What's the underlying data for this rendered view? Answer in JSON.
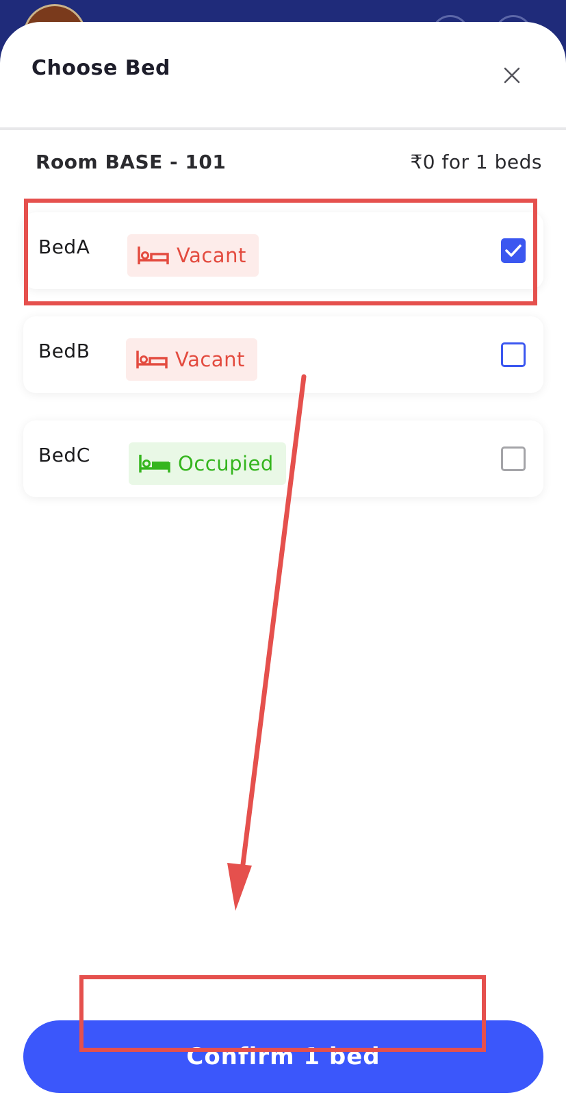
{
  "sheet": {
    "title": "Choose Bed"
  },
  "room": {
    "name": "Room BASE - 101",
    "price_summary": "₹0 for 1 beds"
  },
  "beds": [
    {
      "name": "BedA",
      "status": "Vacant",
      "checked": true
    },
    {
      "name": "BedB",
      "status": "Vacant",
      "checked": false
    },
    {
      "name": "BedC",
      "status": "Occupied",
      "checked": false
    }
  ],
  "confirm": {
    "label": "Confirm 1 bed"
  },
  "icons": {
    "close": "close-icon",
    "vacant": "bed-outline-icon",
    "occupied": "bed-filled-icon",
    "check": "checkmark-icon"
  },
  "colors": {
    "primary": "#3b57fb",
    "vacant": "#e34b3f",
    "occupied": "#35b51e",
    "annotation": "#e5504d",
    "header_bg": "#1f2b7a"
  }
}
